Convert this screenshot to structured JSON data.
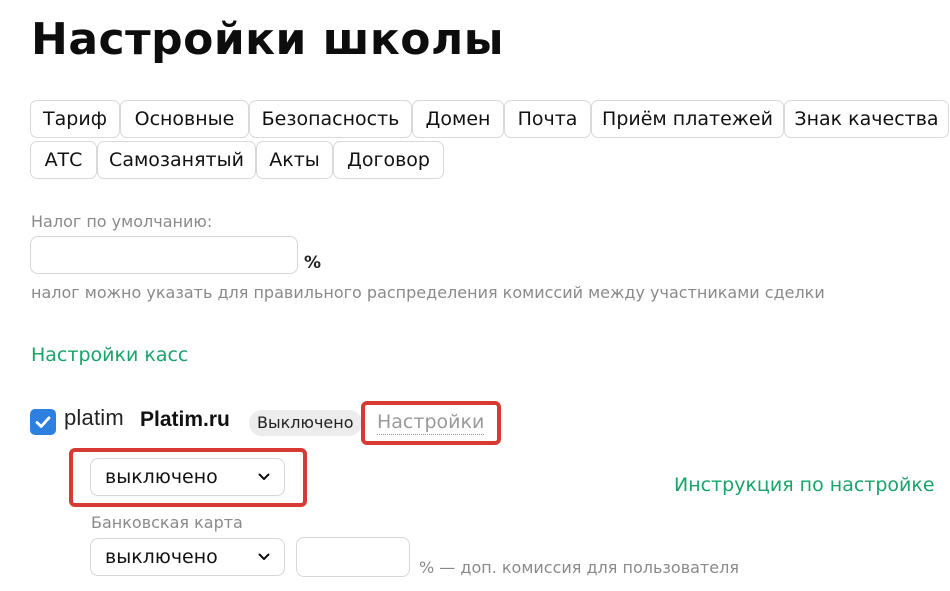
{
  "page": {
    "title": "Настройки школы"
  },
  "tabs": {
    "row1": [
      "Тариф",
      "Основные",
      "Безопасность",
      "Домен",
      "Почта",
      "Приём платежей",
      "Знак качества"
    ],
    "row2": [
      "АТС",
      "Самозанятый",
      "Акты",
      "Договор"
    ]
  },
  "tax": {
    "label": "Налог по умолчанию:",
    "value": "",
    "unit": "%",
    "hint": "налог можно указать для правильного распределения комиссий между участниками сделки"
  },
  "cash_settings": {
    "link": "Настройки касс"
  },
  "provider": {
    "checked": true,
    "logo_text": "platim",
    "name": "Platim.ru",
    "status": "Выключено",
    "settings_link": "Настройки",
    "mode_select": "выключено",
    "instruction_link": "Инструкция по настройке",
    "bank_card_label": "Банковская карта",
    "bank_card_select": "выключено",
    "commission_value": "",
    "commission_hint": "% — доп. комиссия для пользователя"
  },
  "colors": {
    "accent_green": "#1aa36a",
    "highlight_red": "#d63a32",
    "checkbox_blue": "#2d7fe0"
  },
  "icons": {
    "check": "check-icon",
    "chevron": "chevron-down-icon"
  }
}
